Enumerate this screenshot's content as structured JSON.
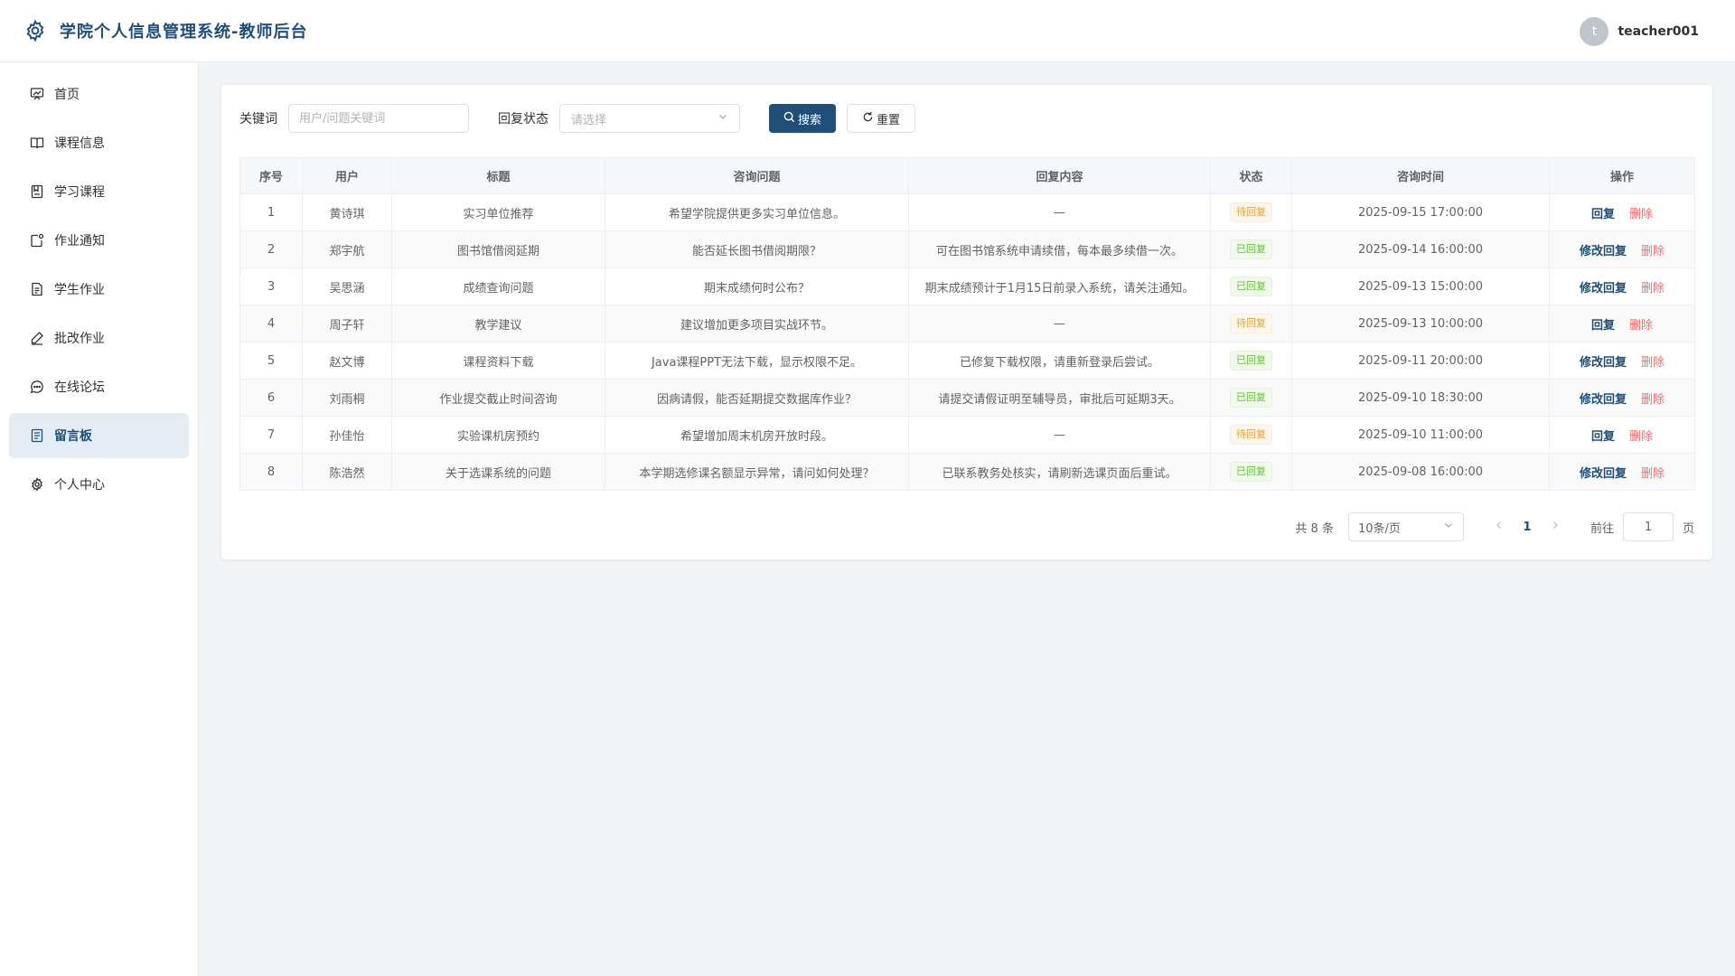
{
  "header": {
    "title": "学院个人信息管理系统-教师后台",
    "avatar_letter": "t",
    "username": "teacher001",
    "logo_icon": "gear-icon"
  },
  "sidebar": {
    "items": [
      {
        "label": "首页",
        "icon": "dashboard-icon"
      },
      {
        "label": "课程信息",
        "icon": "book-icon"
      },
      {
        "label": "学习课程",
        "icon": "notebook-icon"
      },
      {
        "label": "作业通知",
        "icon": "notice-icon"
      },
      {
        "label": "学生作业",
        "icon": "document-icon"
      },
      {
        "label": "批改作业",
        "icon": "pen-icon"
      },
      {
        "label": "在线论坛",
        "icon": "chat-icon"
      },
      {
        "label": "留言板",
        "icon": "message-board-icon",
        "active": true
      },
      {
        "label": "个人中心",
        "icon": "settings-icon"
      }
    ]
  },
  "filter": {
    "keyword_label": "关键词",
    "keyword_placeholder": "用户/问题关键词",
    "status_label": "回复状态",
    "status_placeholder": "请选择",
    "search_label": "搜索",
    "reset_label": "重置"
  },
  "table": {
    "headers": [
      "序号",
      "用户",
      "标题",
      "咨询问题",
      "回复内容",
      "状态",
      "咨询时间",
      "操作"
    ],
    "rows": [
      {
        "no": "1",
        "user": "黄诗琪",
        "title": "实习单位推荐",
        "question": "希望学院提供更多实习单位信息。",
        "reply": "—",
        "status": "待回复",
        "time": "2025-09-15 17:00:00",
        "action": "回复",
        "delete": "删除"
      },
      {
        "no": "2",
        "user": "郑宇航",
        "title": "图书馆借阅延期",
        "question": "能否延长图书借阅期限？",
        "reply": "可在图书馆系统申请续借，每本最多续借一次。",
        "status": "已回复",
        "time": "2025-09-14 16:00:00",
        "action": "修改回复",
        "delete": "删除"
      },
      {
        "no": "3",
        "user": "吴思涵",
        "title": "成绩查询问题",
        "question": "期末成绩何时公布？",
        "reply": "期末成绩预计于1月15日前录入系统，请关注通知。",
        "status": "已回复",
        "time": "2025-09-13 15:00:00",
        "action": "修改回复",
        "delete": "删除"
      },
      {
        "no": "4",
        "user": "周子轩",
        "title": "教学建议",
        "question": "建议增加更多项目实战环节。",
        "reply": "—",
        "status": "待回复",
        "time": "2025-09-13 10:00:00",
        "action": "回复",
        "delete": "删除"
      },
      {
        "no": "5",
        "user": "赵文博",
        "title": "课程资料下载",
        "question": "Java课程PPT无法下载，显示权限不足。",
        "reply": "已修复下载权限，请重新登录后尝试。",
        "status": "已回复",
        "time": "2025-09-11 20:00:00",
        "action": "修改回复",
        "delete": "删除"
      },
      {
        "no": "6",
        "user": "刘雨桐",
        "title": "作业提交截止时间咨询",
        "question": "因病请假，能否延期提交数据库作业？",
        "reply": "请提交请假证明至辅导员，审批后可延期3天。",
        "status": "已回复",
        "time": "2025-09-10 18:30:00",
        "action": "修改回复",
        "delete": "删除"
      },
      {
        "no": "7",
        "user": "孙佳怡",
        "title": "实验课机房预约",
        "question": "希望增加周末机房开放时段。",
        "reply": "—",
        "status": "待回复",
        "time": "2025-09-10 11:00:00",
        "action": "回复",
        "delete": "删除"
      },
      {
        "no": "8",
        "user": "陈浩然",
        "title": "关于选课系统的问题",
        "question": "本学期选修课名额显示异常，请问如何处理？",
        "reply": "已联系教务处核实，请刷新选课页面后重试。",
        "status": "已回复",
        "time": "2025-09-08 16:00:00",
        "action": "修改回复",
        "delete": "删除"
      }
    ]
  },
  "pagination": {
    "total_text": "共 8 条",
    "page_size": "10条/页",
    "current_page": "1",
    "goto_label": "前往",
    "goto_value": "1",
    "page_suffix": "页"
  },
  "colors": {
    "primary": "#1f4e79",
    "pending": "#e6a23c",
    "done": "#67c23a",
    "danger": "#f56c6c"
  }
}
